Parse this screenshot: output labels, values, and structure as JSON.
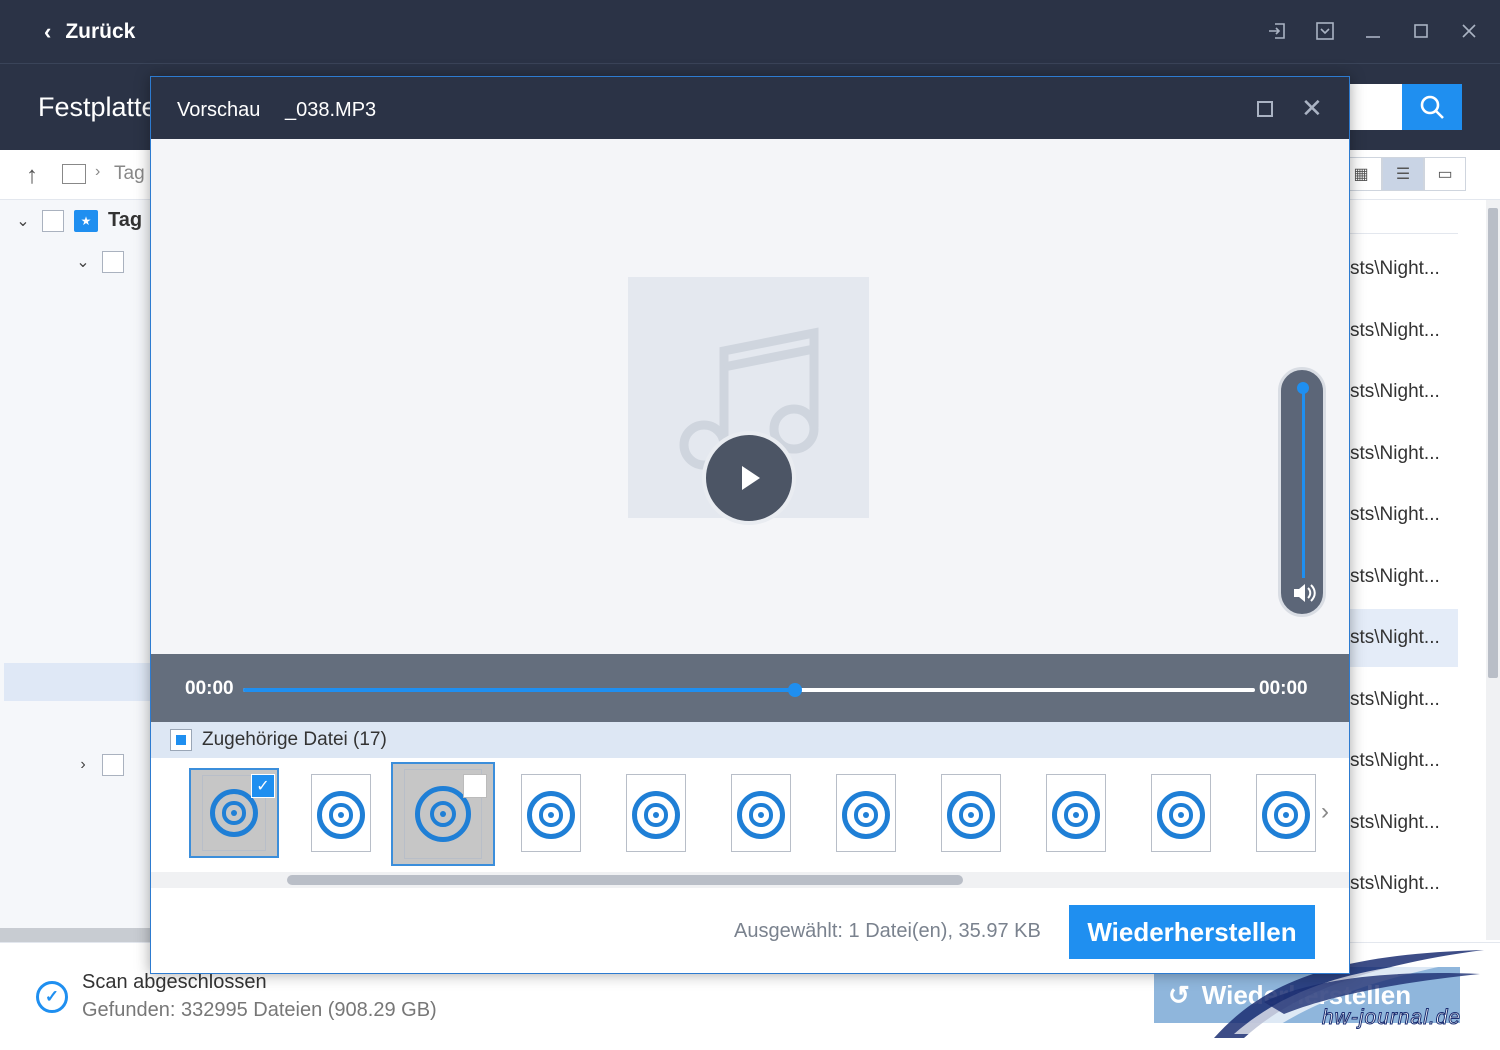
{
  "app": {
    "back_label": "Zurück",
    "header_title": "Festplatte",
    "breadcrumb": "Tag",
    "tree": {
      "root_label": "Tag"
    },
    "file_list_rows": [
      "sts\\Night...",
      "sts\\Night...",
      "sts\\Night...",
      "sts\\Night...",
      "sts\\Night...",
      "sts\\Night...",
      "sts\\Night...",
      "sts\\Night...",
      "sts\\Night...",
      "sts\\Night...",
      "sts\\Night..."
    ],
    "selected_row_index": 6,
    "status": {
      "line1": "Scan abgeschlossen",
      "line2": "Gefunden: 332995 Dateien (908.29 GB)"
    },
    "restore_label": "Wiederherstellen"
  },
  "dialog": {
    "title": "Vorschau",
    "filename": "_038.MP3",
    "player": {
      "time_start": "00:00",
      "time_end": "00:00",
      "progress": 0.545
    },
    "related": {
      "label": "Zugehörige Datei (17)"
    },
    "footer": {
      "selection_info": "Ausgewählt: 1 Datei(en), 35.97 KB",
      "restore_label": "Wiederherstellen"
    }
  },
  "watermark": "hw-journal.de",
  "colors": {
    "accent": "#1f8ff0",
    "titlebar": "#2b3346",
    "player_bar": "#646e7d"
  }
}
